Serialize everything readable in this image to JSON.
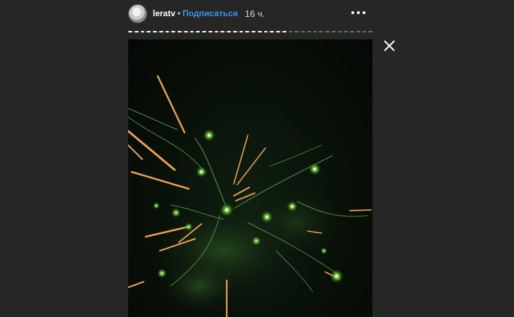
{
  "story": {
    "username": "leratv",
    "separator": "•",
    "follow_label": "Подписаться",
    "time_ago": "16 ч.",
    "progress_segments_total": 40,
    "progress_segments_viewed": 26,
    "colors": {
      "background": "#262626",
      "follow": "#3897f0",
      "progress_active": "#ffffff"
    },
    "icons": {
      "more": "more-options-icon",
      "close": "close-icon"
    }
  }
}
